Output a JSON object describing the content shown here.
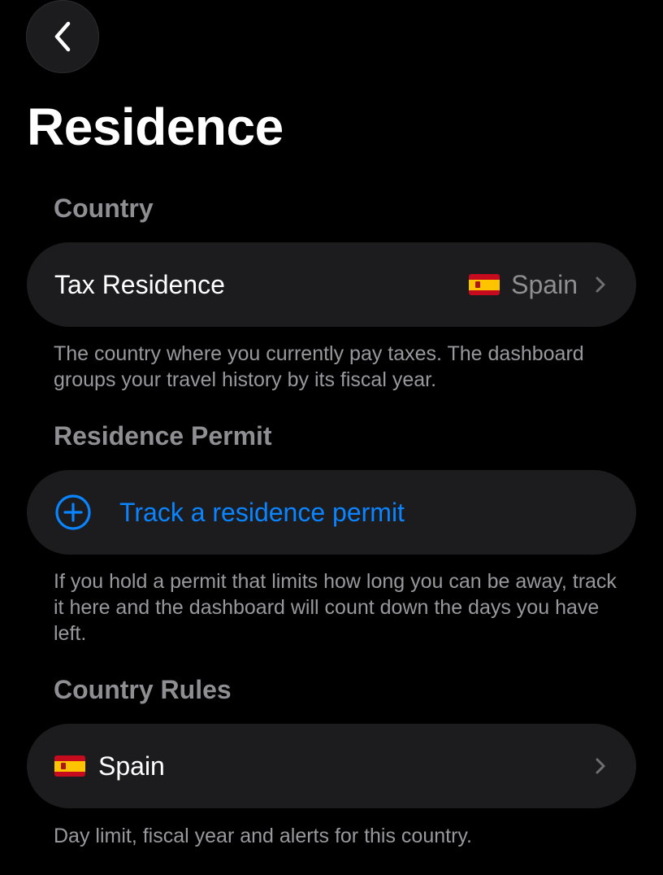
{
  "header": {
    "title": "Residence",
    "back_icon": "chevron-left-icon"
  },
  "colors": {
    "background": "#000000",
    "row_background": "#1c1c1e",
    "accent": "#0a84ff",
    "secondary_text": "#8e8e93"
  },
  "sections": {
    "country": {
      "header": "Country",
      "row_label": "Tax Residence",
      "row_value": "Spain",
      "row_flag": "spain-flag",
      "footnote": "The country where you currently pay taxes. The dashboard groups your travel history by its fiscal year."
    },
    "permit": {
      "header": "Residence Permit",
      "action_label": "Track a residence permit",
      "action_icon": "plus-circle-icon",
      "footnote": "If you hold a permit that limits how long you can be away, track it here and the dashboard will count down the days you have left."
    },
    "rules": {
      "header": "Country Rules",
      "row_label": "Spain",
      "row_flag": "spain-flag",
      "footnote": "Day limit, fiscal year and alerts for this country."
    }
  }
}
